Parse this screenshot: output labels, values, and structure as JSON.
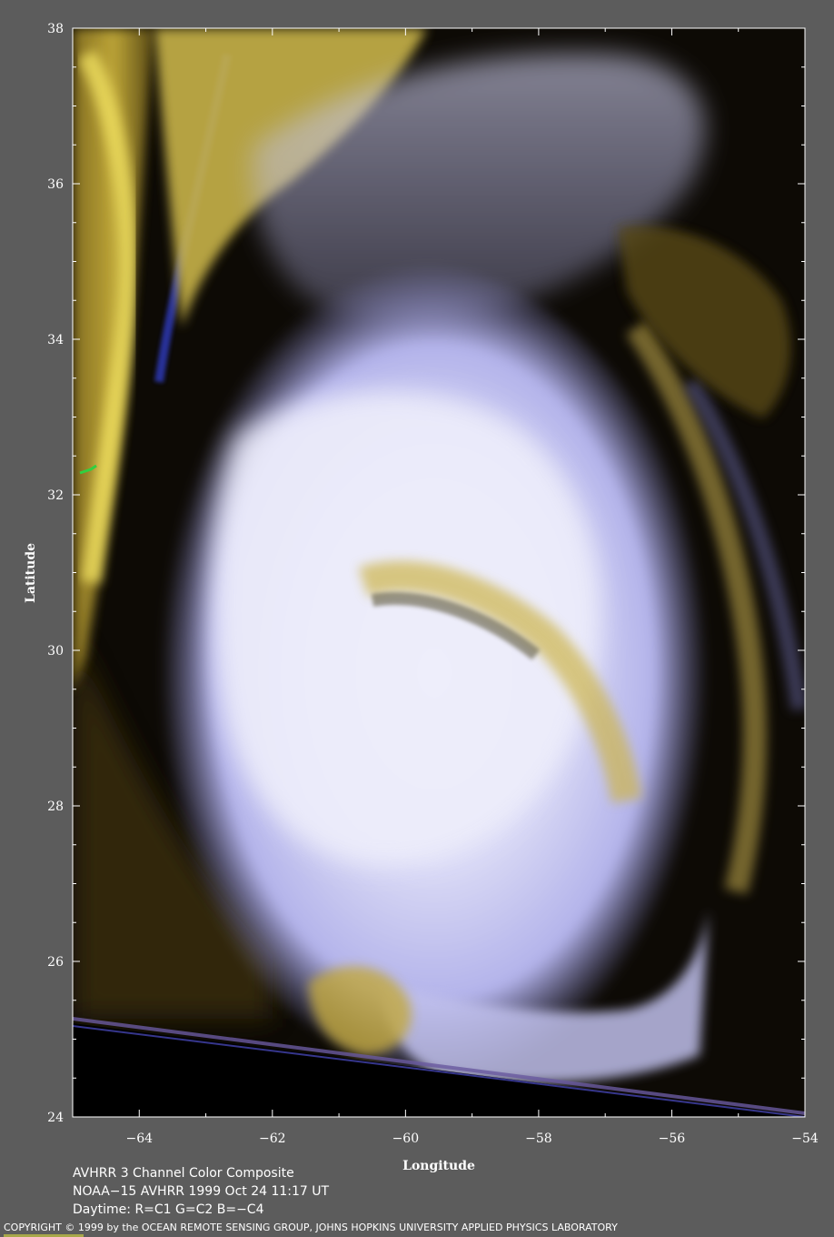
{
  "map": {
    "xlabel": "Longitude",
    "ylabel": "Latitude",
    "x_range": [
      -65,
      -54
    ],
    "y_range": [
      24,
      38
    ],
    "x_ticks": [
      -64,
      -62,
      -60,
      -58,
      -56,
      -54
    ],
    "y_ticks": [
      24,
      26,
      28,
      30,
      32,
      34,
      36,
      38
    ],
    "tick_text": {
      "x": [
        "−64",
        "−62",
        "−60",
        "−58",
        "−56",
        "−54"
      ],
      "y": [
        "24",
        "26",
        "28",
        "30",
        "32",
        "34",
        "36",
        "38"
      ]
    },
    "colors": {
      "background": "#5c5c5c",
      "ocean": "#0d0a05",
      "coast_land": "#6f5a1c",
      "cloud_yellow": "#d8c24a",
      "cloud_white": "#e3e3f6",
      "cloud_lavender": "#a8a8e8",
      "cloud_blue": "#3040b0",
      "frame": "#ffffff"
    }
  },
  "info": {
    "line1": "AVHRR 3 Channel Color Composite",
    "line2": "NOAA−15 AVHRR 1999 Oct 24 11:17 UT",
    "line3": "Daytime: R=C1 G=C2 B=−C4"
  },
  "copyright": "COPYRIGHT © 1999 by the OCEAN REMOTE SENSING GROUP, JOHNS HOPKINS UNIVERSITY APPLIED PHYSICS LABORATORY"
}
